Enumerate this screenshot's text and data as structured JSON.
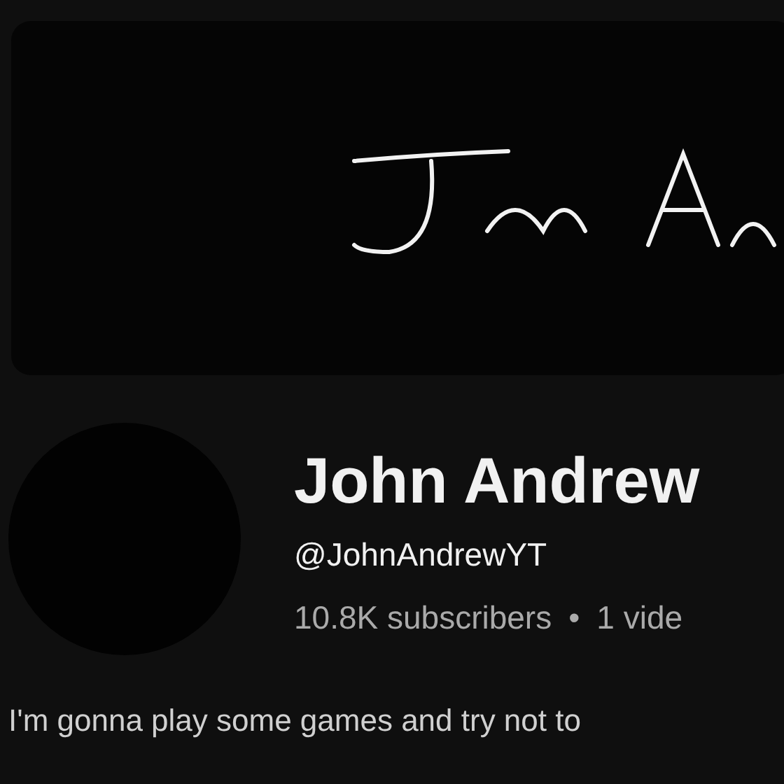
{
  "channel": {
    "name": "John Andrew",
    "handle": "@JohnAndrewYT",
    "subscribers": "10.8K subscribers",
    "separator": "•",
    "videos": "1 vide"
  },
  "description": "I'm gonna play some games and try not to"
}
